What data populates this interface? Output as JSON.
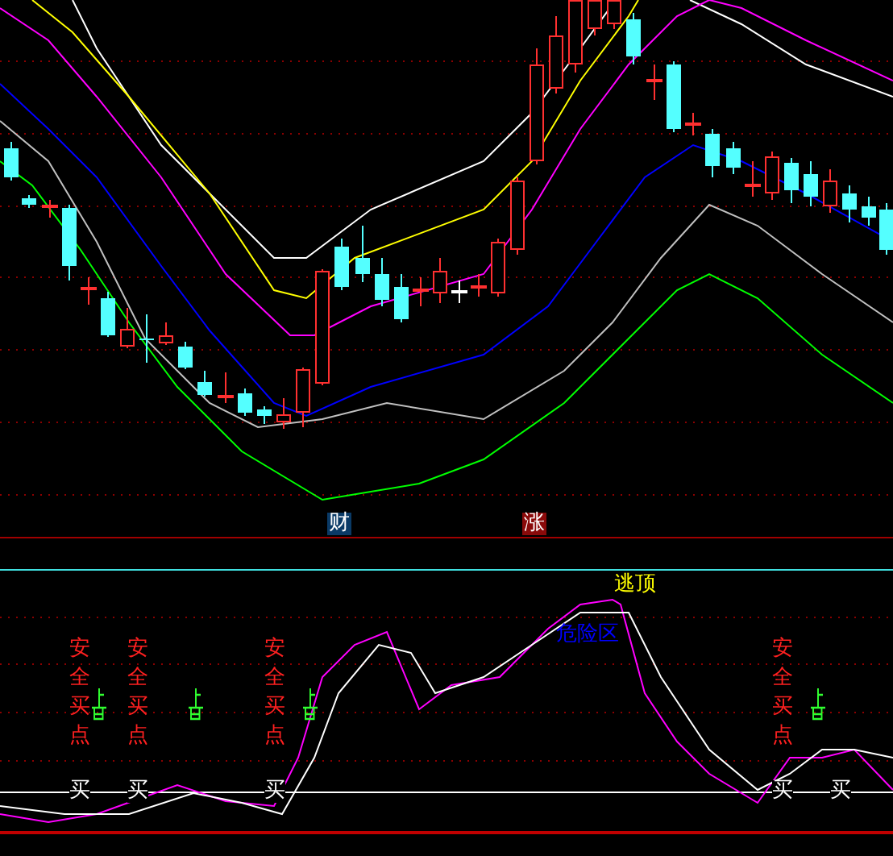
{
  "price_panel": {
    "markers": [
      {
        "text": "财",
        "kind": "finance"
      },
      {
        "text": "涨",
        "kind": "rise"
      }
    ]
  },
  "indicator_panel": {
    "top_label": "逃顶",
    "zone_label": "危险区",
    "buy_signals": [
      "安全买点",
      "安全买点",
      "安全买点",
      "安全买点"
    ],
    "buy_marks": [
      "买",
      "买",
      "买",
      "买",
      "买"
    ]
  }
}
